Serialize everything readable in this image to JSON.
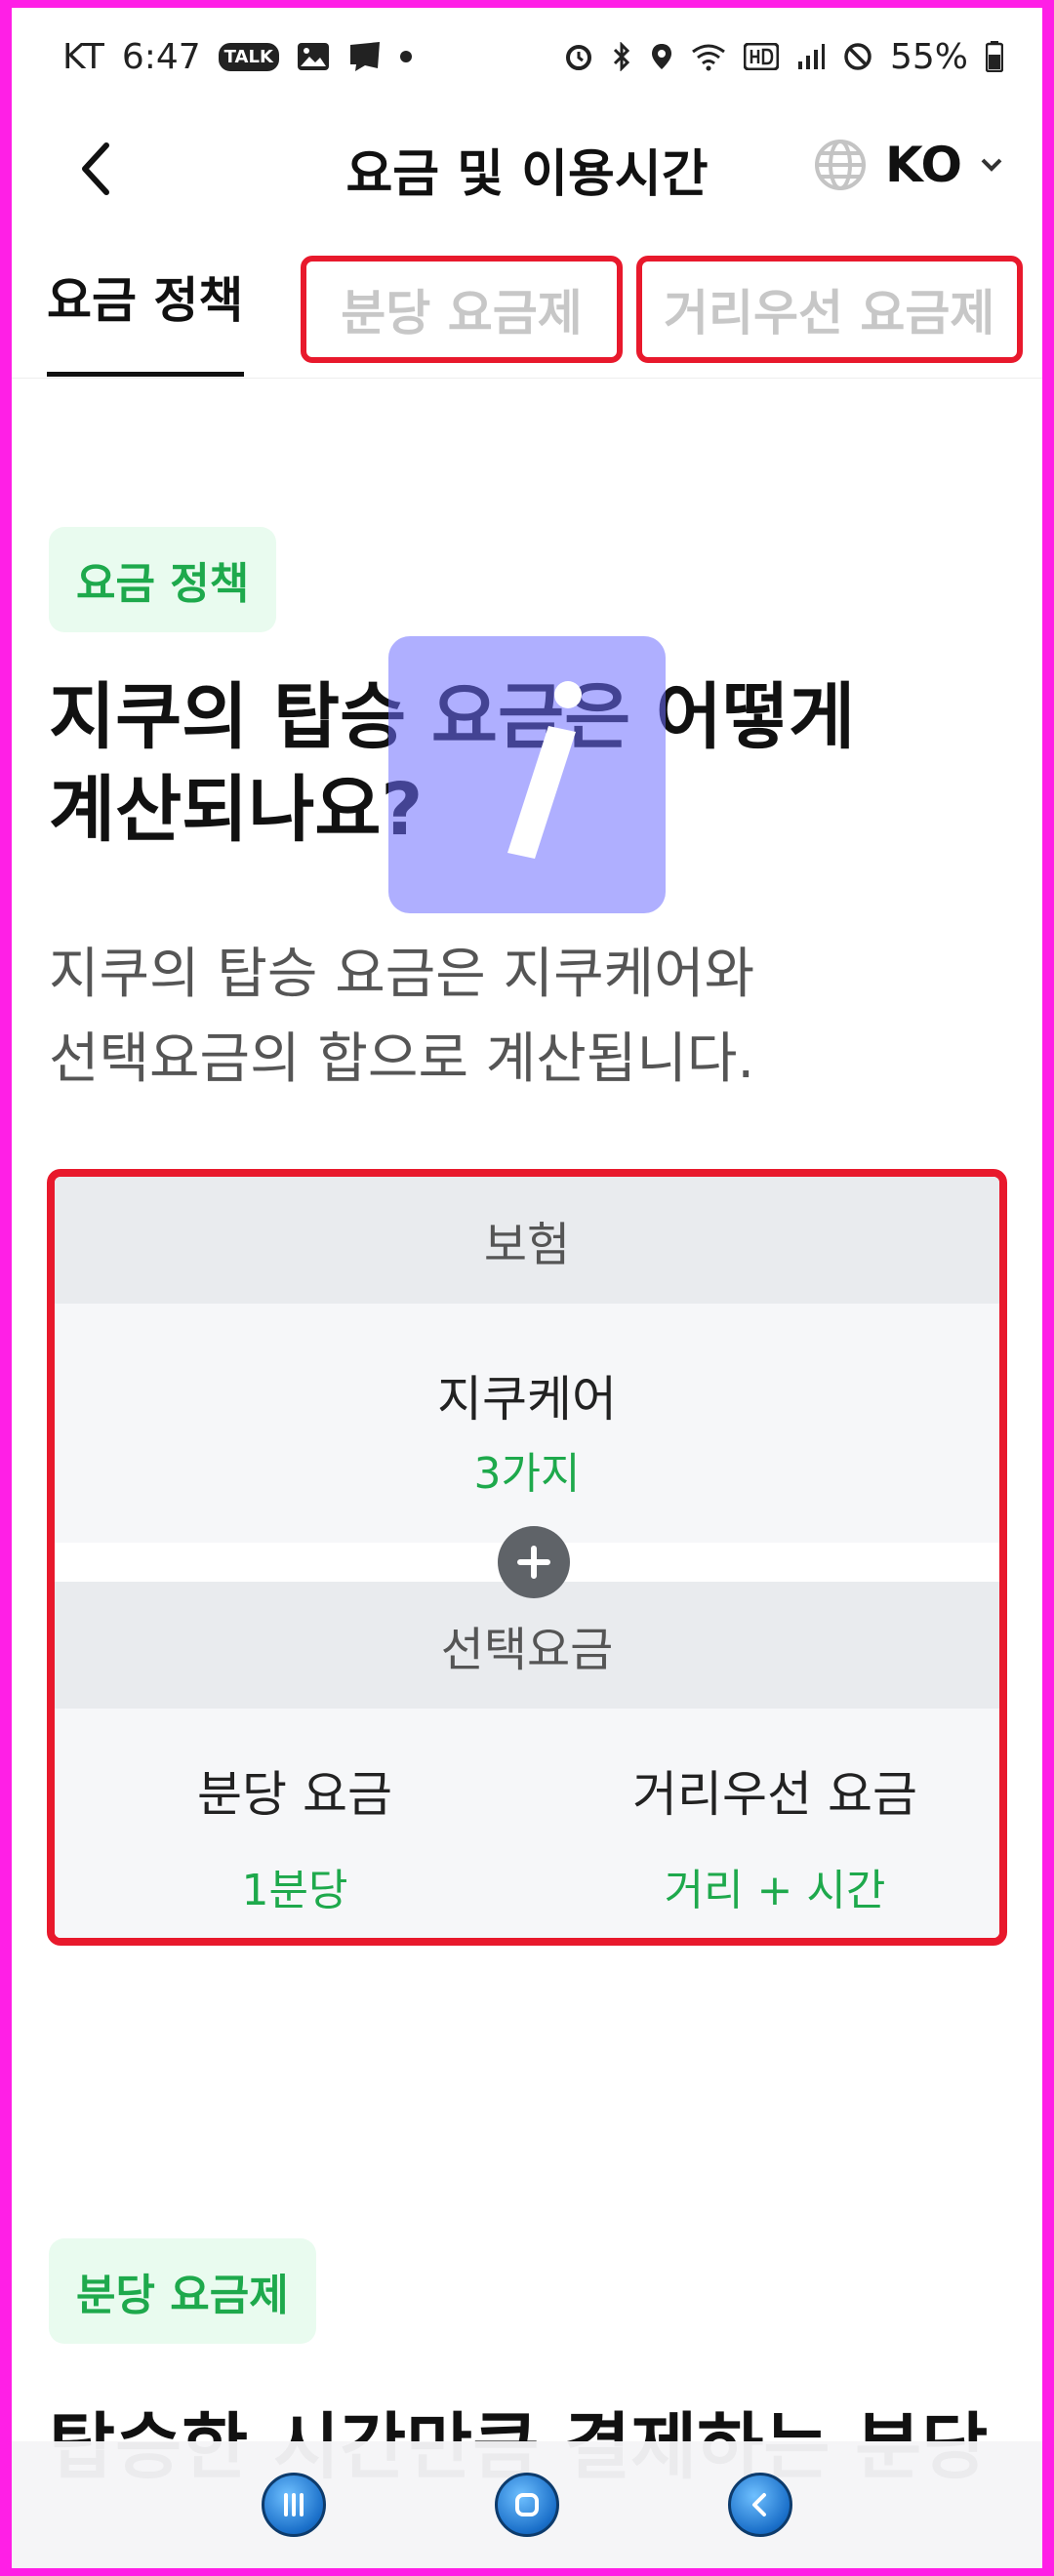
{
  "status_bar": {
    "carrier": "KT",
    "time": "6:47",
    "battery": "55%",
    "left_icons": [
      "talk-icon",
      "gallery-icon",
      "webtoon-icon",
      "dot-icon"
    ],
    "right_icons": [
      "alarm-icon",
      "bluetooth-icon",
      "location-icon",
      "wifi-icon",
      "hd-icon",
      "signal-icon",
      "do-not-disturb-icon",
      "battery-icon"
    ],
    "talk_label": "TALK"
  },
  "app_bar": {
    "title": "요금 및 이용시간",
    "language": "KO"
  },
  "tabs": [
    {
      "label": "요금 정책",
      "active": true
    },
    {
      "label": "분당 요금제",
      "active": false
    },
    {
      "label": "거리우선 요금제",
      "active": false
    }
  ],
  "section_policy": {
    "badge": "요금 정책",
    "headline_line1": "지쿠의 탑승 요금은 어떻게",
    "headline_line2": "계산되나요?",
    "desc_line1": "지쿠의 탑승 요금은 지쿠케어와",
    "desc_line2": "선택요금의 합으로 계산됩니다."
  },
  "fee_box": {
    "insurance_label": "보험",
    "care_title": "지쿠케어",
    "care_value": "3가지",
    "option_label": "선택요금",
    "options": [
      {
        "title": "분당 요금",
        "value": "1분당"
      },
      {
        "title": "거리우선 요금",
        "value": "거리 + 시간"
      }
    ]
  },
  "section_minute": {
    "badge": "분당 요금제",
    "headline": "탑승한 시간만큼 결제하는 분당"
  },
  "colors": {
    "accent_green": "#1ea94c",
    "highlight_red": "#e8192c",
    "frame_magenta": "#ff1fe6"
  }
}
